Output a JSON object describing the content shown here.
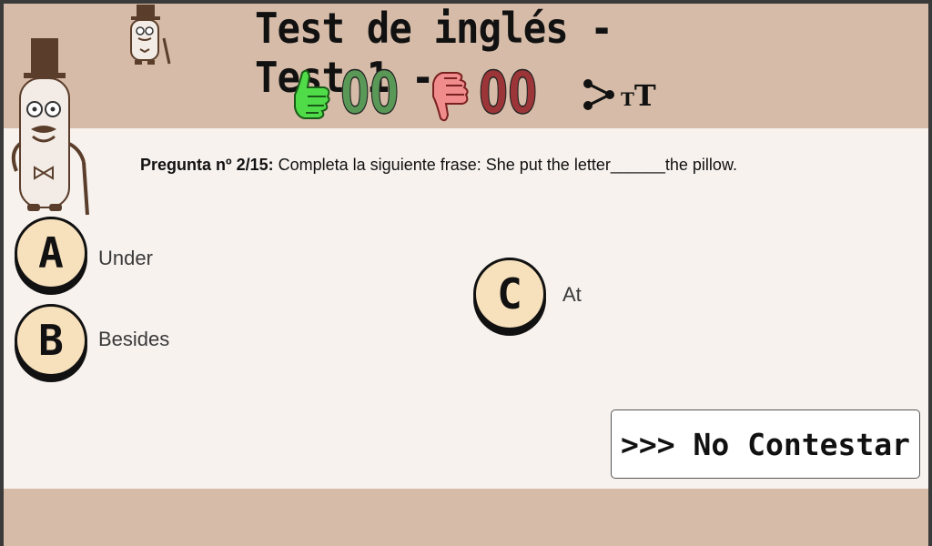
{
  "header": {
    "title": "Test de inglés - Test 1 -",
    "correct_count": "00",
    "wrong_count": "00",
    "thumbs_up_icon": "thumbs-up-icon",
    "thumbs_down_icon": "thumbs-down-icon",
    "share_icon": "share-icon",
    "text_size_icon": "text-size-icon",
    "text_size_small": "T",
    "text_size_big": "T"
  },
  "question": {
    "prefix": "Pregunta nº 2/15:",
    "text": " Completa la siguiente frase: She put the letter______the pillow."
  },
  "options": [
    {
      "letter": "A",
      "label": "Under"
    },
    {
      "letter": "B",
      "label": "Besides"
    },
    {
      "letter": "C",
      "label": "At"
    }
  ],
  "skip_button": {
    "label": ">>> No Contestar"
  },
  "colors": {
    "header_bg": "#d6bca8",
    "content_bg": "#f7f2ee",
    "correct": "#5a9858",
    "wrong": "#9c3538",
    "option_fill": "#f7e0bc"
  }
}
